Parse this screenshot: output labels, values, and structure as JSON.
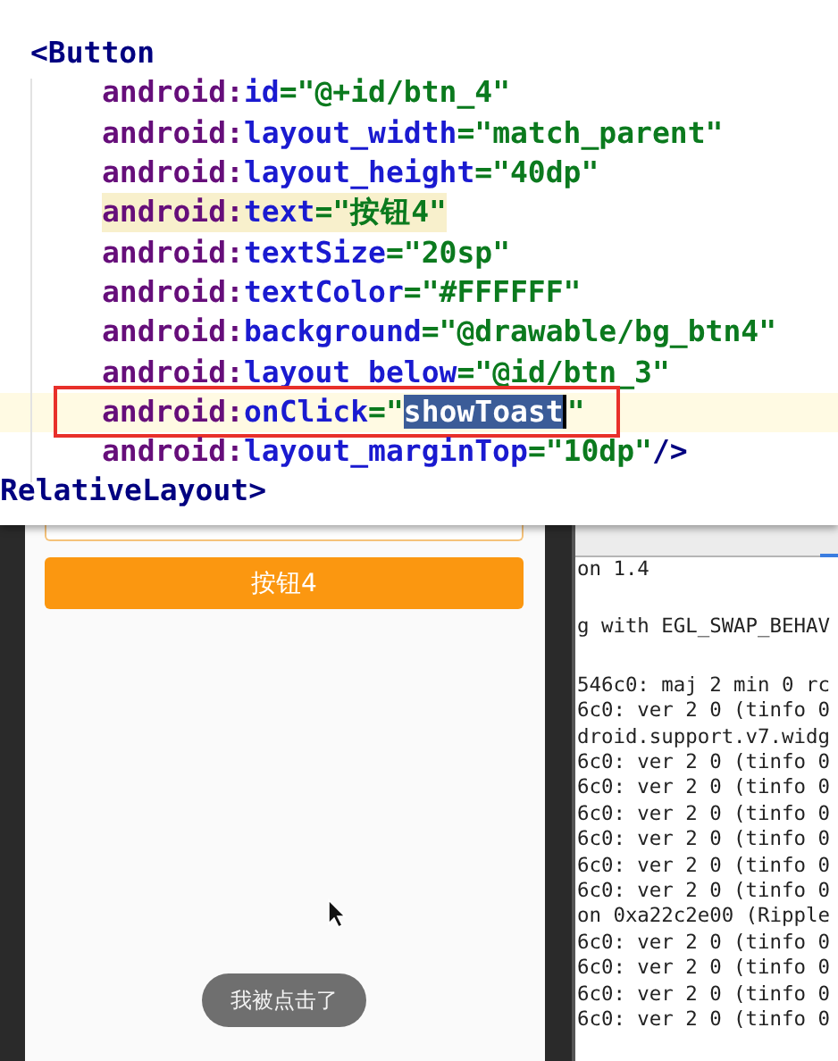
{
  "code_editor": {
    "lines": [
      {
        "kind": "tag",
        "highlighted": false,
        "current": false,
        "boxed": false,
        "tokens": [
          {
            "text": "<Button",
            "kind": "tag"
          }
        ]
      },
      {
        "kind": "attribute",
        "highlighted": false,
        "current": false,
        "boxed": false,
        "tokens": [
          {
            "text": "android:",
            "kind": "namespace"
          },
          {
            "text": "id",
            "kind": "attr"
          },
          {
            "text": "=\"@+id/btn_4\"",
            "kind": "value"
          }
        ]
      },
      {
        "kind": "attribute",
        "highlighted": false,
        "current": false,
        "boxed": false,
        "tokens": [
          {
            "text": "android:",
            "kind": "namespace"
          },
          {
            "text": "layout_width",
            "kind": "attr"
          },
          {
            "text": "=\"match_parent\"",
            "kind": "value"
          }
        ]
      },
      {
        "kind": "attribute",
        "highlighted": false,
        "current": false,
        "boxed": false,
        "tokens": [
          {
            "text": "android:",
            "kind": "namespace"
          },
          {
            "text": "layout_height",
            "kind": "attr"
          },
          {
            "text": "=\"40dp\"",
            "kind": "value"
          }
        ]
      },
      {
        "kind": "attribute",
        "highlighted": true,
        "current": false,
        "boxed": false,
        "tokens": [
          {
            "text": "android:",
            "kind": "namespace"
          },
          {
            "text": "text",
            "kind": "attr"
          },
          {
            "text": "=\"按钮4\"",
            "kind": "value"
          }
        ]
      },
      {
        "kind": "attribute",
        "highlighted": false,
        "current": false,
        "boxed": false,
        "tokens": [
          {
            "text": "android:",
            "kind": "namespace"
          },
          {
            "text": "textSize",
            "kind": "attr"
          },
          {
            "text": "=\"20sp\"",
            "kind": "value"
          }
        ]
      },
      {
        "kind": "attribute",
        "highlighted": false,
        "current": false,
        "boxed": false,
        "tokens": [
          {
            "text": "android:",
            "kind": "namespace"
          },
          {
            "text": "textColor",
            "kind": "attr"
          },
          {
            "text": "=\"#FFFFFF\"",
            "kind": "value"
          }
        ]
      },
      {
        "kind": "attribute",
        "highlighted": false,
        "current": false,
        "boxed": false,
        "tokens": [
          {
            "text": "android:",
            "kind": "namespace"
          },
          {
            "text": "background",
            "kind": "attr"
          },
          {
            "text": "=\"@drawable/bg_btn4\"",
            "kind": "value"
          }
        ]
      },
      {
        "kind": "attribute",
        "highlighted": false,
        "current": false,
        "boxed": false,
        "tokens": [
          {
            "text": "android:",
            "kind": "namespace"
          },
          {
            "text": "layout_below",
            "kind": "attr"
          },
          {
            "text": "=\"@id/btn_3\"",
            "kind": "value"
          }
        ]
      },
      {
        "kind": "attribute",
        "highlighted": false,
        "current": true,
        "boxed": true,
        "tokens": [
          {
            "text": "android:",
            "kind": "namespace"
          },
          {
            "text": "onClick",
            "kind": "attr"
          },
          {
            "text": "=\"",
            "kind": "value"
          },
          {
            "text": "showToast",
            "kind": "value",
            "selected": true
          },
          {
            "text": "\"",
            "kind": "value"
          }
        ]
      },
      {
        "kind": "attribute",
        "highlighted": false,
        "current": false,
        "boxed": false,
        "tokens": [
          {
            "text": "android:",
            "kind": "namespace"
          },
          {
            "text": "layout_marginTop",
            "kind": "attr"
          },
          {
            "text": "=\"10dp\"",
            "kind": "value"
          },
          {
            "text": "/>",
            "kind": "tag"
          }
        ]
      },
      {
        "kind": "close_tag",
        "highlighted": false,
        "current": false,
        "boxed": false,
        "tokens": [
          {
            "text": "RelativeLayout>",
            "kind": "tag"
          }
        ]
      }
    ]
  },
  "emulator": {
    "buttons": [
      {
        "kind": "outlined"
      },
      {
        "kind": "filled",
        "label": "按钮4"
      }
    ],
    "toast": "我被点击了"
  },
  "logcat": {
    "lines": [
      {
        "text": "on 1.4",
        "gap_before": false
      },
      {
        "text": "g with EGL_SWAP_BEHAV",
        "gap_before": true
      },
      {
        "text": "546c0: maj 2 min 0 rc",
        "gap_before": true
      },
      {
        "text": "6c0: ver 2 0 (tinfo 0",
        "gap_before": false
      },
      {
        "text": "droid.support.v7.widg",
        "gap_before": false
      },
      {
        "text": "6c0: ver 2 0 (tinfo 0",
        "gap_before": false
      },
      {
        "text": "6c0: ver 2 0 (tinfo 0",
        "gap_before": false
      },
      {
        "text": "6c0: ver 2 0 (tinfo 0",
        "gap_before": false
      },
      {
        "text": "6c0: ver 2 0 (tinfo 0",
        "gap_before": false
      },
      {
        "text": "6c0: ver 2 0 (tinfo 0",
        "gap_before": false
      },
      {
        "text": "6c0: ver 2 0 (tinfo 0",
        "gap_before": false
      },
      {
        "text": "on 0xa22c2e00 (Ripple",
        "gap_before": false
      },
      {
        "text": "6c0: ver 2 0 (tinfo 0",
        "gap_before": false
      },
      {
        "text": "6c0: ver 2 0 (tinfo 0",
        "gap_before": false
      },
      {
        "text": "6c0: ver 2 0 (tinfo 0",
        "gap_before": false
      },
      {
        "text": "6c0: ver 2 0 (tinfo 0",
        "gap_before": false
      }
    ]
  }
}
